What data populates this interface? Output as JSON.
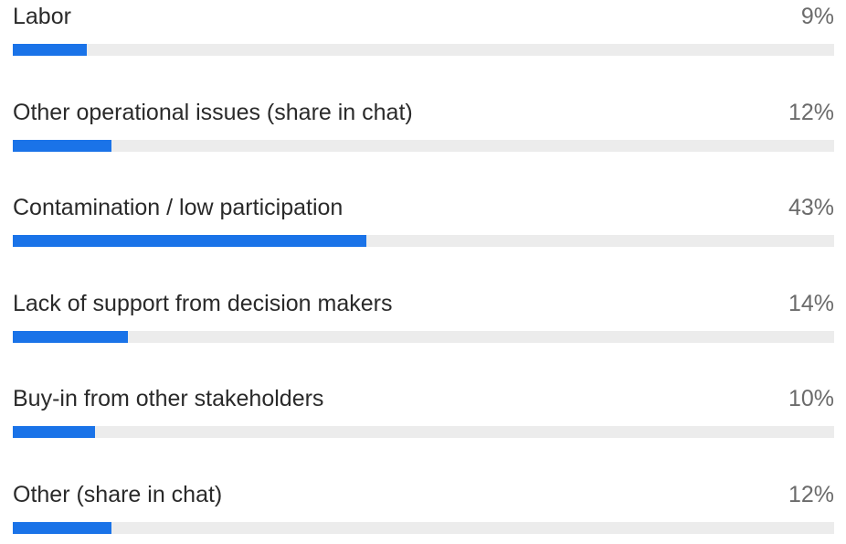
{
  "colors": {
    "bar_fill": "#1a73e8",
    "track": "#ececec",
    "label_text": "#2a2a2a",
    "percent_text": "#6b6b6b"
  },
  "chart_data": {
    "type": "bar",
    "orientation": "horizontal",
    "categories": [
      "Labor",
      "Other operational issues (share in chat)",
      "Contamination / low participation",
      "Lack of support from decision makers",
      "Buy-in from other stakeholders",
      "Other (share in chat)"
    ],
    "values": [
      9,
      12,
      43,
      14,
      10,
      12
    ],
    "value_labels": [
      "9%",
      "12%",
      "43%",
      "14%",
      "10%",
      "12%"
    ],
    "unit": "%",
    "xlim": [
      0,
      100
    ],
    "grid": false,
    "legend": "none"
  }
}
